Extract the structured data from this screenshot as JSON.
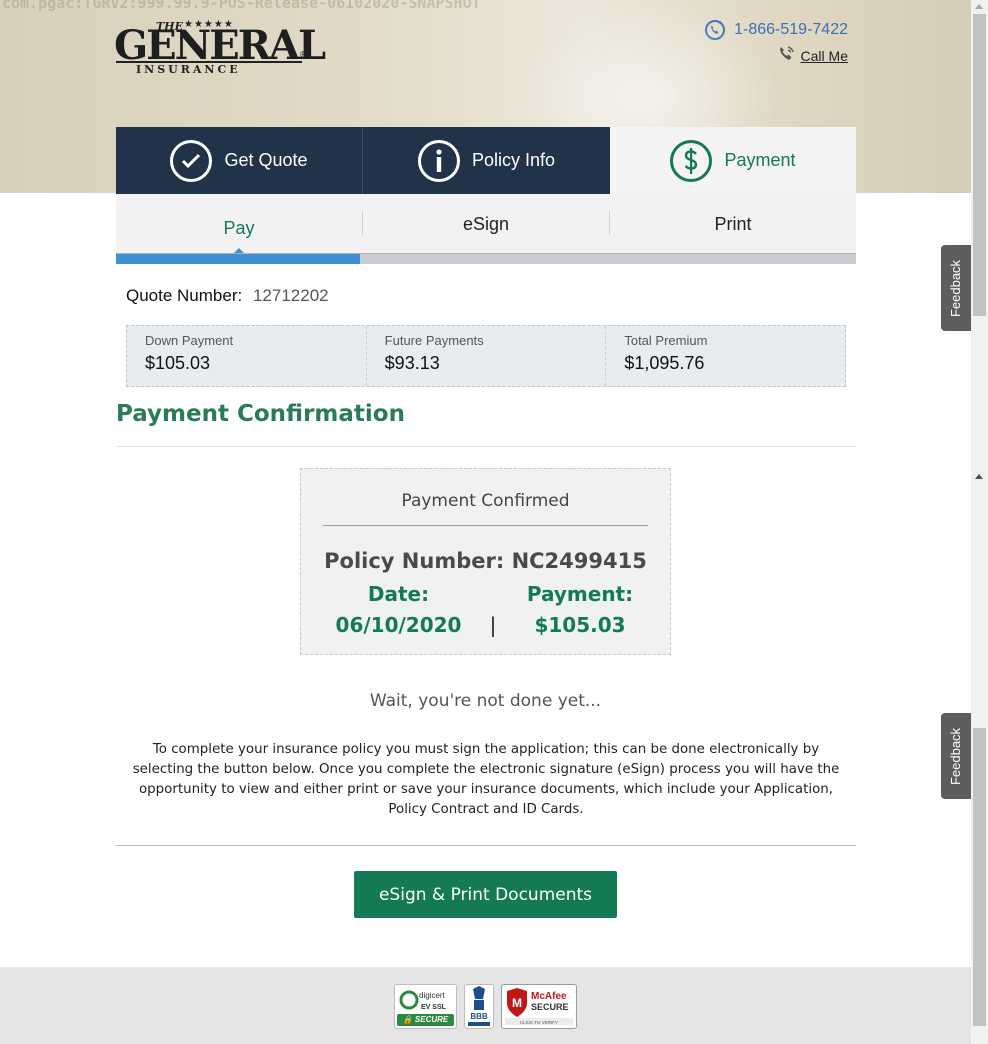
{
  "header": {
    "build_watermark": "com.pgac:TGRV2:999.99.9-POS-Release-06102020-SNAPSHOT",
    "logo": {
      "the": "THE",
      "stars": "★★★★★",
      "name": "GENERAL",
      "reg": "®",
      "insurance": "INSURANCE"
    },
    "phone": "1-866-519-7422",
    "call_me": "Call Me"
  },
  "main_tabs": [
    {
      "label": "Get Quote",
      "icon": "check-circle-icon",
      "state": "done"
    },
    {
      "label": "Policy Info",
      "icon": "info-circle-icon",
      "state": "done"
    },
    {
      "label": "Payment",
      "icon": "dollar-circle-icon",
      "state": "active"
    }
  ],
  "sub_tabs": [
    {
      "label": "Pay",
      "active": true
    },
    {
      "label": "eSign",
      "active": false
    },
    {
      "label": "Print",
      "active": false
    }
  ],
  "progress_fraction": 0.33,
  "quote": {
    "label": "Quote Number:",
    "value": "12712202"
  },
  "summary": [
    {
      "label": "Down Payment",
      "value": "$105.03"
    },
    {
      "label": "Future Payments",
      "value": "$93.13"
    },
    {
      "label": "Total Premium",
      "value": "$1,095.76"
    }
  ],
  "section_title": "Payment Confirmation",
  "confirmation": {
    "heading": "Payment Confirmed",
    "policy_label": "Policy Number:",
    "policy_number": "NC2499415",
    "date_label": "Date:",
    "date_value": "06/10/2020",
    "separator": "|",
    "payment_label": "Payment:",
    "payment_value": "$105.03"
  },
  "wait_text": "Wait, you're not done yet...",
  "instructions": "To complete your insurance policy you must sign the application; this can be done electronically by selecting the button below. Once you complete the electronic signature (eSign) process you will have the opportunity to view and either print or save your insurance documents, which include your Application, Policy Contract and ID Cards.",
  "cta_label": "eSign & Print Documents",
  "feedback_label": "Feedback",
  "badges": {
    "digicert": {
      "brand": "digicert",
      "line2": "EV SSL",
      "footer": "SECURE"
    },
    "bbb": {
      "text": "BBB"
    },
    "mcafee": {
      "brand": "McAfee",
      "line2": "SECURE",
      "footer": "CLICK TO VERIFY"
    }
  },
  "colors": {
    "brand_green": "#137a54",
    "nav_dark": "#213349",
    "progress_blue": "#3f8fd4",
    "phone_blue": "#3a6fb5"
  }
}
